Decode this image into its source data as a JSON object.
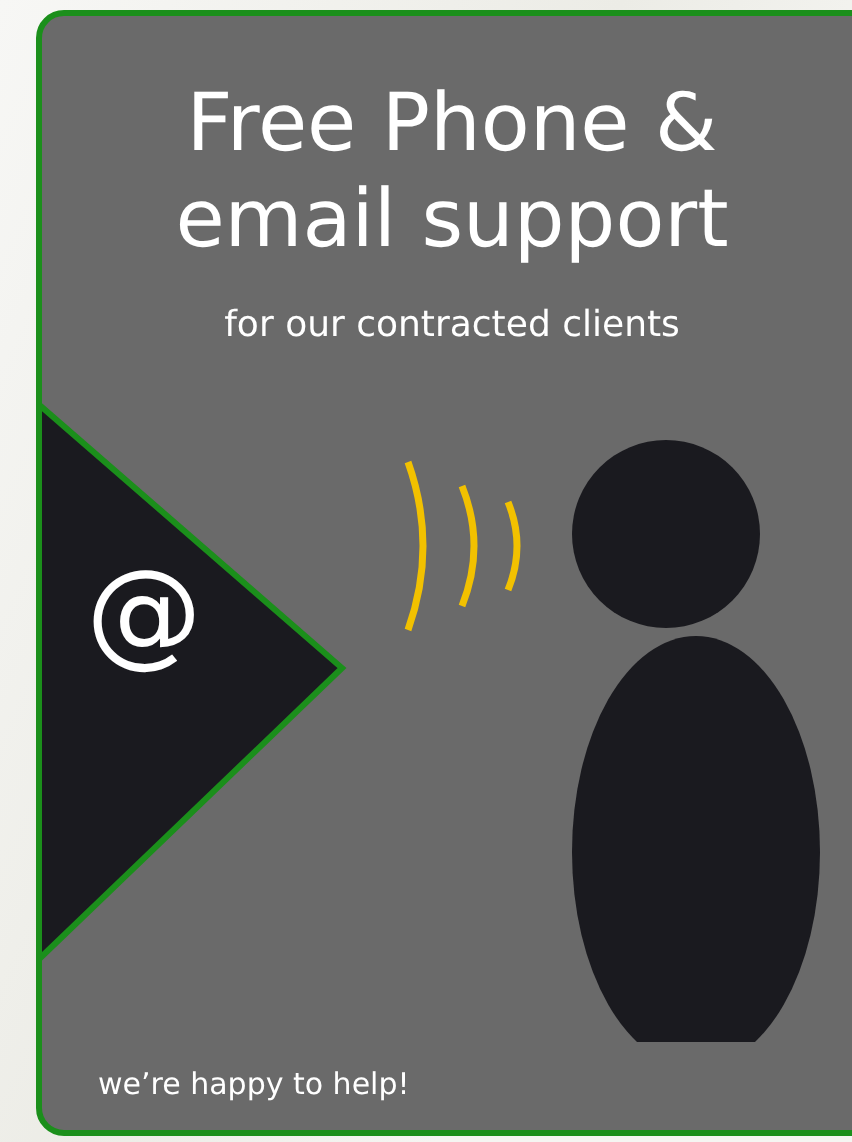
{
  "title_lines": [
    "Free Phone &",
    "email support"
  ],
  "subtitle": "for our contracted clients",
  "at_sign": "@",
  "footer": "we’re happy to help!"
}
